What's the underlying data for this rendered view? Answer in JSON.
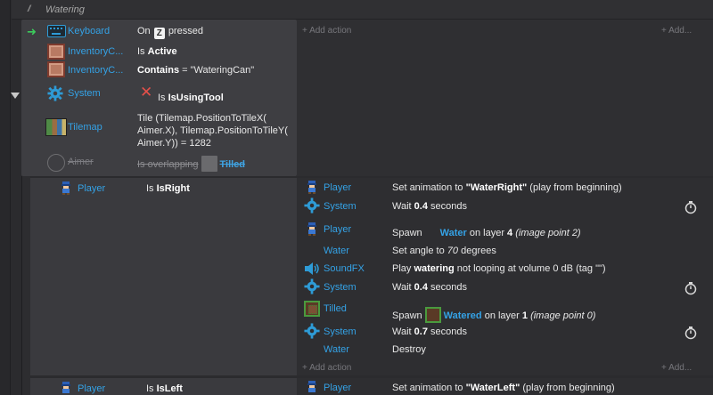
{
  "comment": {
    "text": "Watering"
  },
  "parent": {
    "conditions": [
      {
        "object": "Keyboard",
        "pre": "On",
        "key": "Z",
        "post": "pressed"
      },
      {
        "object": "InventoryC...",
        "pre": "Is",
        "bold": "Active"
      },
      {
        "object": "InventoryC...",
        "bold": "Contains",
        "post": " = \"WateringCan\""
      },
      {
        "object": "System",
        "pre": "Is",
        "bold": "IsUsingTool"
      },
      {
        "object": "Tilemap",
        "line1": "Tile (Tilemap.PositionToTileX(",
        "line2": "Aimer.X), Tilemap.PositionToTileY(",
        "line3": "Aimer.Y)) = 1282"
      },
      {
        "object": "Aimer",
        "pre": "Is overlapping",
        "target": "Tilled"
      }
    ],
    "add_action": "+ Add action",
    "add_more": "+ Add..."
  },
  "sub_right": {
    "condition": {
      "object": "Player",
      "pre": "Is",
      "bold": "IsRight"
    },
    "actions": [
      {
        "object": "Player",
        "pre": "Set animation to ",
        "bold": "\"WaterRight\"",
        "post": " (play from beginning)"
      },
      {
        "object": "System",
        "pre": "Wait ",
        "bold": "0.4",
        "post": " seconds"
      },
      {
        "object": "Player",
        "pre": "Spawn",
        "blue": "Water",
        "mid": " on layer ",
        "bold": "4",
        "italic": " (image point 2)"
      },
      {
        "object": "Water",
        "pre": "Set angle to ",
        "italic": "70",
        "post": " degrees"
      },
      {
        "object": "SoundFX",
        "pre": "Play ",
        "bold": "watering",
        "post": " not looping at volume 0 dB (tag \"\")"
      },
      {
        "object": "System",
        "pre": "Wait ",
        "bold": "0.4",
        "post": " seconds"
      },
      {
        "object": "Tilled",
        "pre": "Spawn",
        "blue": "Watered",
        "mid": " on layer ",
        "bold": "1",
        "italic": " (image point 0)"
      },
      {
        "object": "System",
        "pre": "Wait ",
        "bold": "0.7",
        "post": " seconds"
      },
      {
        "object": "Water",
        "pre": "Destroy"
      }
    ],
    "add_action": "+ Add action",
    "add_more": "+ Add..."
  },
  "sub_left": {
    "condition": {
      "object": "Player",
      "pre": "Is",
      "bold": "IsLeft"
    },
    "actions": [
      {
        "object": "Player",
        "pre": "Set animation to ",
        "bold": "\"WaterLeft\"",
        "post": " (play from beginning)"
      }
    ]
  },
  "colors": {
    "object_blue": "#34a2e6",
    "trigger_green": "#3ccb5c",
    "invert_red": "#e5504a"
  }
}
